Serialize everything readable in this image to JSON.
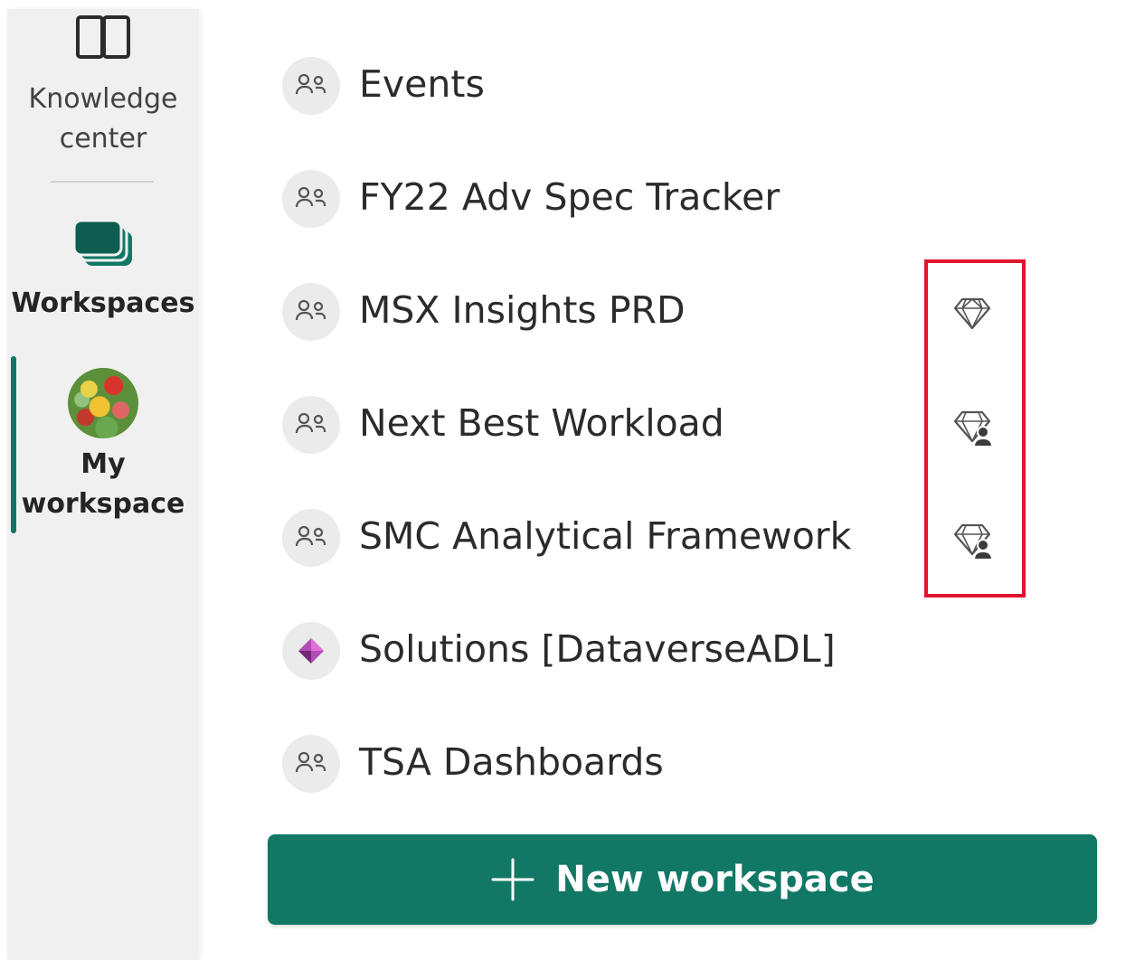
{
  "rail": {
    "knowledge_center": {
      "line1": "Knowledge",
      "line2": "center"
    },
    "workspaces": "Workspaces",
    "my_workspace": {
      "line1": "My",
      "line2": "workspace"
    }
  },
  "workspaces": [
    {
      "name": "Events",
      "icon": "people-icon",
      "premium": null
    },
    {
      "name": "FY22 Adv Spec Tracker",
      "icon": "people-icon",
      "premium": null
    },
    {
      "name": "MSX Insights PRD",
      "icon": "people-icon",
      "premium": "premium-diamond-icon"
    },
    {
      "name": "Next Best Workload",
      "icon": "people-icon",
      "premium": "premium-per-user-icon"
    },
    {
      "name": "SMC Analytical Framework",
      "icon": "people-icon",
      "premium": "premium-per-user-icon"
    },
    {
      "name": "Solutions [DataverseADL]",
      "icon": "power-apps-icon",
      "premium": null
    },
    {
      "name": "TSA Dashboards",
      "icon": "people-icon",
      "premium": null
    }
  ],
  "new_workspace_button": "New workspace",
  "colors": {
    "accent": "#117865",
    "highlight": "#e0142f",
    "rail_bg": "#f0f0f0"
  }
}
